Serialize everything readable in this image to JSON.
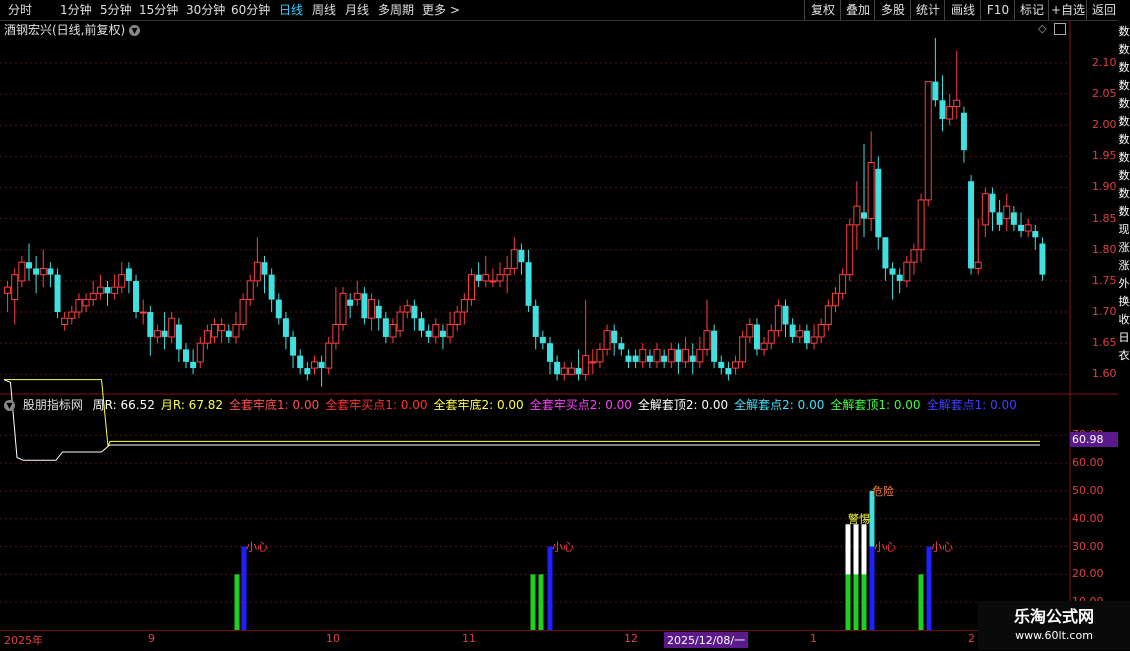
{
  "toolbar": {
    "periods": [
      "分时",
      "1分钟",
      "5分钟",
      "15分钟",
      "30分钟",
      "60分钟",
      "日线",
      "周线",
      "月线",
      "多周期",
      "更多 >"
    ],
    "active": "日线",
    "right_buttons": [
      "复权",
      "叠加",
      "多股",
      "统计",
      "画线",
      "F10",
      "标记",
      "+自选",
      "返回"
    ]
  },
  "main": {
    "title": "酒钢宏兴(日线,前复权)",
    "price_ticks": [
      "2.10",
      "2.05",
      "2.00",
      "1.95",
      "1.90",
      "1.85",
      "1.80",
      "1.75",
      "1.70",
      "1.65",
      "1.60"
    ]
  },
  "indicator": {
    "name": "股朋指标网",
    "items": [
      {
        "label": "周R: 66.52",
        "color": "#ffffff"
      },
      {
        "label": "月R: 67.82",
        "color": "#ffff40"
      },
      {
        "label": "全套牢底1: 0.00",
        "color": "#ff5050"
      },
      {
        "label": "全套牢买点1: 0.00",
        "color": "#ff3030"
      },
      {
        "label": "全套牢底2: 0.00",
        "color": "#ffff40"
      },
      {
        "label": "全套牢买点2: 0.00",
        "color": "#ff40ff"
      },
      {
        "label": "全解套顶2: 0.00",
        "color": "#ffffff"
      },
      {
        "label": "全解套点2: 0.00",
        "color": "#40e0ff"
      },
      {
        "label": "全解套顶1: 0.00",
        "color": "#40ff40"
      },
      {
        "label": "全解套点1: 0.00",
        "color": "#4040ff"
      }
    ],
    "ticks": [
      "70.00",
      "60.00",
      "50.00",
      "40.00",
      "30.00",
      "20.00",
      "10.00"
    ],
    "current_value": "60.98",
    "annotations": [
      "小心",
      "小心",
      "小心",
      "小心",
      "危险",
      "警惕"
    ]
  },
  "dates": [
    "2025年",
    "9",
    "10",
    "11",
    "12",
    "2025/12/08/一",
    "1",
    "2"
  ],
  "right_column_text": [
    "数",
    "数",
    "数",
    "数",
    "数",
    "数",
    "数",
    "数",
    "数",
    "数",
    "数",
    "现",
    "涨",
    "涨",
    "外",
    "换",
    "收",
    "日",
    "衣"
  ],
  "logo": {
    "line1": "乐淘公式网",
    "line2": "www.60lt.com"
  },
  "chart_data": {
    "type": "candlestick",
    "title": "酒钢宏兴(日线,前复权)",
    "ylim": [
      1.57,
      2.14
    ],
    "candles": [
      [
        1.73,
        1.74,
        1.7,
        1.75
      ],
      [
        1.72,
        1.76,
        1.68,
        1.77
      ],
      [
        1.75,
        1.78,
        1.74,
        1.79
      ],
      [
        1.78,
        1.77,
        1.75,
        1.81
      ],
      [
        1.77,
        1.76,
        1.73,
        1.79
      ],
      [
        1.76,
        1.77,
        1.74,
        1.8
      ],
      [
        1.77,
        1.76,
        1.74,
        1.78
      ],
      [
        1.76,
        1.7,
        1.69,
        1.77
      ],
      [
        1.68,
        1.69,
        1.67,
        1.7
      ],
      [
        1.69,
        1.7,
        1.68,
        1.71
      ],
      [
        1.7,
        1.72,
        1.69,
        1.73
      ],
      [
        1.71,
        1.72,
        1.7,
        1.73
      ],
      [
        1.72,
        1.73,
        1.71,
        1.75
      ],
      [
        1.73,
        1.74,
        1.72,
        1.76
      ],
      [
        1.74,
        1.73,
        1.71,
        1.75
      ],
      [
        1.73,
        1.74,
        1.72,
        1.76
      ],
      [
        1.74,
        1.76,
        1.73,
        1.78
      ],
      [
        1.77,
        1.75,
        1.73,
        1.78
      ],
      [
        1.75,
        1.7,
        1.69,
        1.76
      ],
      [
        1.7,
        1.7,
        1.68,
        1.72
      ],
      [
        1.7,
        1.66,
        1.63,
        1.71
      ],
      [
        1.66,
        1.67,
        1.65,
        1.68
      ],
      [
        1.67,
        1.66,
        1.64,
        1.7
      ],
      [
        1.66,
        1.69,
        1.65,
        1.7
      ],
      [
        1.68,
        1.64,
        1.62,
        1.69
      ],
      [
        1.64,
        1.62,
        1.61,
        1.65
      ],
      [
        1.62,
        1.61,
        1.6,
        1.64
      ],
      [
        1.62,
        1.65,
        1.61,
        1.66
      ],
      [
        1.65,
        1.67,
        1.64,
        1.68
      ],
      [
        1.66,
        1.68,
        1.65,
        1.69
      ],
      [
        1.67,
        1.68,
        1.65,
        1.69
      ],
      [
        1.67,
        1.66,
        1.65,
        1.68
      ],
      [
        1.66,
        1.68,
        1.65,
        1.7
      ],
      [
        1.68,
        1.72,
        1.67,
        1.73
      ],
      [
        1.72,
        1.75,
        1.71,
        1.76
      ],
      [
        1.75,
        1.78,
        1.74,
        1.82
      ],
      [
        1.78,
        1.76,
        1.73,
        1.79
      ],
      [
        1.76,
        1.72,
        1.7,
        1.77
      ],
      [
        1.72,
        1.69,
        1.68,
        1.73
      ],
      [
        1.69,
        1.66,
        1.64,
        1.7
      ],
      [
        1.66,
        1.63,
        1.61,
        1.67
      ],
      [
        1.63,
        1.61,
        1.6,
        1.64
      ],
      [
        1.61,
        1.6,
        1.59,
        1.62
      ],
      [
        1.61,
        1.62,
        1.6,
        1.63
      ],
      [
        1.62,
        1.61,
        1.58,
        1.63
      ],
      [
        1.61,
        1.65,
        1.6,
        1.66
      ],
      [
        1.65,
        1.68,
        1.64,
        1.74
      ],
      [
        1.68,
        1.73,
        1.67,
        1.74
      ],
      [
        1.72,
        1.71,
        1.69,
        1.73
      ],
      [
        1.72,
        1.73,
        1.71,
        1.75
      ],
      [
        1.73,
        1.69,
        1.68,
        1.74
      ],
      [
        1.69,
        1.72,
        1.67,
        1.73
      ],
      [
        1.71,
        1.69,
        1.67,
        1.72
      ],
      [
        1.69,
        1.66,
        1.65,
        1.7
      ],
      [
        1.66,
        1.68,
        1.65,
        1.69
      ],
      [
        1.67,
        1.7,
        1.66,
        1.71
      ],
      [
        1.7,
        1.71,
        1.69,
        1.72
      ],
      [
        1.71,
        1.69,
        1.67,
        1.72
      ],
      [
        1.69,
        1.67,
        1.66,
        1.7
      ],
      [
        1.67,
        1.66,
        1.65,
        1.68
      ],
      [
        1.66,
        1.68,
        1.65,
        1.69
      ],
      [
        1.67,
        1.66,
        1.64,
        1.68
      ],
      [
        1.66,
        1.68,
        1.65,
        1.7
      ],
      [
        1.68,
        1.7,
        1.67,
        1.71
      ],
      [
        1.7,
        1.72,
        1.68,
        1.73
      ],
      [
        1.72,
        1.76,
        1.71,
        1.77
      ],
      [
        1.76,
        1.75,
        1.74,
        1.78
      ],
      [
        1.75,
        1.76,
        1.74,
        1.79
      ],
      [
        1.75,
        1.75,
        1.74,
        1.77
      ],
      [
        1.75,
        1.76,
        1.74,
        1.78
      ],
      [
        1.76,
        1.77,
        1.73,
        1.79
      ],
      [
        1.77,
        1.8,
        1.76,
        1.82
      ],
      [
        1.8,
        1.78,
        1.76,
        1.81
      ],
      [
        1.78,
        1.71,
        1.7,
        1.8
      ],
      [
        1.71,
        1.66,
        1.64,
        1.72
      ],
      [
        1.66,
        1.65,
        1.64,
        1.67
      ],
      [
        1.65,
        1.62,
        1.6,
        1.66
      ],
      [
        1.62,
        1.6,
        1.59,
        1.63
      ],
      [
        1.6,
        1.61,
        1.59,
        1.62
      ],
      [
        1.6,
        1.61,
        1.6,
        1.62
      ],
      [
        1.61,
        1.6,
        1.59,
        1.64
      ],
      [
        1.6,
        1.63,
        1.59,
        1.72
      ],
      [
        1.62,
        1.62,
        1.6,
        1.64
      ],
      [
        1.62,
        1.64,
        1.61,
        1.65
      ],
      [
        1.64,
        1.67,
        1.63,
        1.68
      ],
      [
        1.67,
        1.65,
        1.63,
        1.68
      ],
      [
        1.65,
        1.64,
        1.63,
        1.66
      ],
      [
        1.63,
        1.62,
        1.61,
        1.64
      ],
      [
        1.63,
        1.62,
        1.61,
        1.64
      ],
      [
        1.62,
        1.64,
        1.61,
        1.65
      ],
      [
        1.63,
        1.62,
        1.61,
        1.64
      ],
      [
        1.62,
        1.64,
        1.61,
        1.65
      ],
      [
        1.63,
        1.62,
        1.61,
        1.64
      ],
      [
        1.62,
        1.64,
        1.61,
        1.65
      ],
      [
        1.64,
        1.62,
        1.6,
        1.65
      ],
      [
        1.62,
        1.64,
        1.61,
        1.66
      ],
      [
        1.63,
        1.62,
        1.6,
        1.65
      ],
      [
        1.62,
        1.64,
        1.61,
        1.66
      ],
      [
        1.64,
        1.67,
        1.63,
        1.72
      ],
      [
        1.67,
        1.62,
        1.61,
        1.68
      ],
      [
        1.62,
        1.61,
        1.6,
        1.63
      ],
      [
        1.61,
        1.6,
        1.59,
        1.62
      ],
      [
        1.61,
        1.62,
        1.6,
        1.63
      ],
      [
        1.62,
        1.66,
        1.61,
        1.67
      ],
      [
        1.66,
        1.68,
        1.65,
        1.69
      ],
      [
        1.68,
        1.64,
        1.63,
        1.69
      ],
      [
        1.64,
        1.65,
        1.63,
        1.66
      ],
      [
        1.65,
        1.67,
        1.64,
        1.68
      ],
      [
        1.67,
        1.71,
        1.66,
        1.72
      ],
      [
        1.71,
        1.68,
        1.66,
        1.72
      ],
      [
        1.68,
        1.66,
        1.65,
        1.69
      ],
      [
        1.66,
        1.67,
        1.65,
        1.68
      ],
      [
        1.67,
        1.65,
        1.64,
        1.68
      ],
      [
        1.65,
        1.66,
        1.64,
        1.68
      ],
      [
        1.66,
        1.68,
        1.65,
        1.69
      ],
      [
        1.68,
        1.71,
        1.67,
        1.72
      ],
      [
        1.71,
        1.73,
        1.7,
        1.74
      ],
      [
        1.73,
        1.76,
        1.72,
        1.77
      ],
      [
        1.76,
        1.84,
        1.75,
        1.85
      ],
      [
        1.84,
        1.87,
        1.8,
        1.91
      ],
      [
        1.86,
        1.85,
        1.82,
        1.97
      ],
      [
        1.85,
        1.94,
        1.83,
        1.99
      ],
      [
        1.93,
        1.82,
        1.8,
        1.95
      ],
      [
        1.82,
        1.77,
        1.75,
        1.82
      ],
      [
        1.77,
        1.76,
        1.72,
        1.78
      ],
      [
        1.76,
        1.75,
        1.73,
        1.77
      ],
      [
        1.75,
        1.78,
        1.74,
        1.79
      ],
      [
        1.78,
        1.8,
        1.76,
        1.81
      ],
      [
        1.8,
        1.88,
        1.78,
        1.89
      ],
      [
        1.88,
        2.07,
        1.87,
        2.07
      ],
      [
        2.07,
        2.04,
        2.03,
        2.14
      ],
      [
        2.04,
        2.01,
        1.99,
        2.08
      ],
      [
        2.01,
        2.03,
        2.0,
        2.05
      ],
      [
        2.03,
        2.04,
        2.01,
        2.12
      ],
      [
        2.02,
        1.96,
        1.94,
        2.03
      ],
      [
        1.91,
        1.77,
        1.76,
        1.92
      ],
      [
        1.77,
        1.78,
        1.76,
        1.85
      ],
      [
        1.84,
        1.89,
        1.82,
        1.9
      ],
      [
        1.89,
        1.86,
        1.83,
        1.9
      ],
      [
        1.86,
        1.84,
        1.83,
        1.88
      ],
      [
        1.85,
        1.87,
        1.83,
        1.89
      ],
      [
        1.86,
        1.84,
        1.83,
        1.87
      ],
      [
        1.84,
        1.83,
        1.82,
        1.86
      ],
      [
        1.83,
        1.84,
        1.82,
        1.85
      ],
      [
        1.83,
        1.82,
        1.8,
        1.84
      ],
      [
        1.81,
        1.76,
        1.75,
        1.82
      ]
    ],
    "indicator_series": [
      {
        "name": "周R",
        "color": "#ffffff",
        "values_start": [
          90,
          89,
          62,
          61,
          61,
          61,
          61,
          61,
          61,
          64,
          64,
          64,
          64,
          64,
          64,
          64,
          66
        ],
        "value_end": 66.52
      },
      {
        "name": "月R",
        "color": "#ffff40",
        "values_start": [
          90,
          90,
          90,
          90,
          90,
          90,
          90,
          90,
          90,
          90,
          90,
          90,
          90,
          90,
          90,
          90,
          66
        ],
        "value_end": 67.82
      }
    ],
    "indicator_ylim": [
      0,
      78
    ]
  }
}
